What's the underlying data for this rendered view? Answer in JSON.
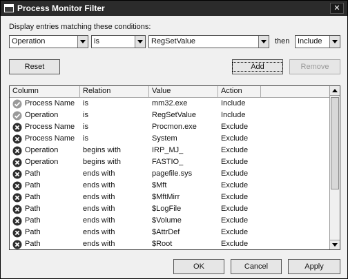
{
  "window": {
    "title": "Process Monitor Filter",
    "close_glyph": "✕"
  },
  "prompt": "Display entries matching these conditions:",
  "condition": {
    "column": "Operation",
    "relation": "is",
    "value": "RegSetValue",
    "then_label": "then",
    "action": "Include"
  },
  "buttons": {
    "reset": "Reset",
    "add": "Add",
    "remove": "Remove",
    "ok": "OK",
    "cancel": "Cancel",
    "apply": "Apply"
  },
  "table": {
    "headers": [
      "Column",
      "Relation",
      "Value",
      "Action"
    ],
    "rows": [
      {
        "icon": "check",
        "column": "Process Name",
        "relation": "is",
        "value": "mm32.exe",
        "action": "Include"
      },
      {
        "icon": "check",
        "column": "Operation",
        "relation": "is",
        "value": "RegSetValue",
        "action": "Include"
      },
      {
        "icon": "x",
        "column": "Process Name",
        "relation": "is",
        "value": "Procmon.exe",
        "action": "Exclude"
      },
      {
        "icon": "x",
        "column": "Process Name",
        "relation": "is",
        "value": "System",
        "action": "Exclude"
      },
      {
        "icon": "x",
        "column": "Operation",
        "relation": "begins with",
        "value": "IRP_MJ_",
        "action": "Exclude"
      },
      {
        "icon": "x",
        "column": "Operation",
        "relation": "begins with",
        "value": "FASTIO_",
        "action": "Exclude"
      },
      {
        "icon": "x",
        "column": "Path",
        "relation": "ends with",
        "value": "pagefile.sys",
        "action": "Exclude"
      },
      {
        "icon": "x",
        "column": "Path",
        "relation": "ends with",
        "value": "$Mft",
        "action": "Exclude"
      },
      {
        "icon": "x",
        "column": "Path",
        "relation": "ends with",
        "value": "$MftMirr",
        "action": "Exclude"
      },
      {
        "icon": "x",
        "column": "Path",
        "relation": "ends with",
        "value": "$LogFile",
        "action": "Exclude"
      },
      {
        "icon": "x",
        "column": "Path",
        "relation": "ends with",
        "value": "$Volume",
        "action": "Exclude"
      },
      {
        "icon": "x",
        "column": "Path",
        "relation": "ends with",
        "value": "$AttrDef",
        "action": "Exclude"
      },
      {
        "icon": "x",
        "column": "Path",
        "relation": "ends with",
        "value": "$Root",
        "action": "Exclude"
      }
    ]
  },
  "colors": {
    "titlebar": "#2b2b2b",
    "include_icon": "#9a9a9a",
    "exclude_icon": "#2f2f2f"
  }
}
